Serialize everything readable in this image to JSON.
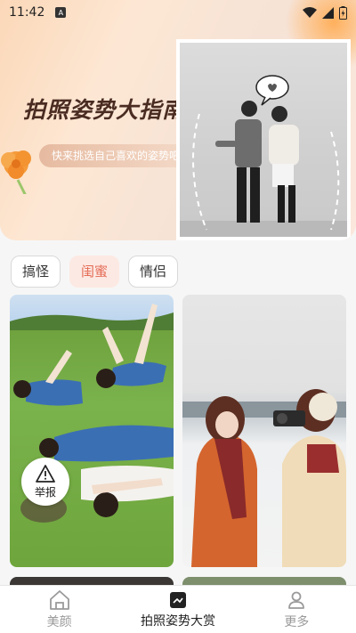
{
  "status": {
    "time": "11:42",
    "indicator": "A"
  },
  "banner": {
    "title": "拍照姿势大指南",
    "subtitle": "快来挑选自己喜欢的姿势吧"
  },
  "tabs": [
    {
      "label": "搞怪",
      "active": false
    },
    {
      "label": "闺蜜",
      "active": true
    },
    {
      "label": "情侣",
      "active": false
    }
  ],
  "cards": {
    "report_label": "举报"
  },
  "bottom_nav": [
    {
      "label": "美颜",
      "icon": "house-icon",
      "active": false
    },
    {
      "label": "拍照姿势大赏",
      "icon": "photo-icon",
      "active": true
    },
    {
      "label": "更多",
      "icon": "person-icon",
      "active": false
    }
  ],
  "colors": {
    "accent": "#e46b55",
    "tab_active_bg": "#fde9e3"
  }
}
